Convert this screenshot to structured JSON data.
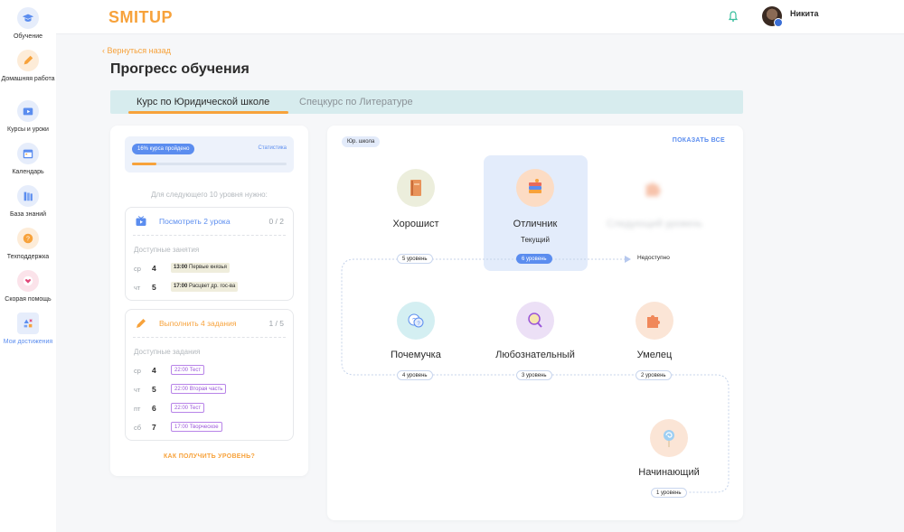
{
  "sidebar": {
    "items": [
      {
        "label": "Обучение",
        "icon": "graduation-cap-icon",
        "color": "#5b8def"
      },
      {
        "label": "Домашняя работа",
        "icon": "pencil-icon",
        "color": "#f7a23b"
      },
      {
        "label": "Курсы и уроки",
        "icon": "video-icon",
        "color": "#5b8def"
      },
      {
        "label": "Календарь",
        "icon": "calendar-icon",
        "color": "#5b8def"
      },
      {
        "label": "База знаний",
        "icon": "books-icon",
        "color": "#5b8def"
      },
      {
        "label": "Техподдержка",
        "icon": "question-icon",
        "color": "#f7a23b"
      },
      {
        "label": "Скорая помощь",
        "icon": "heart-icon",
        "color": "#e0497a"
      },
      {
        "label": "Мои достижения",
        "icon": "shapes-icon",
        "color": "#5b8def",
        "active": true
      }
    ]
  },
  "header": {
    "logo": "SMITUP",
    "user_name": "Никита"
  },
  "page": {
    "back_label": "Вернуться назад",
    "title": "Прогресс обучения",
    "tabs": [
      {
        "label": "Курс по Юридической  школе",
        "active": true
      },
      {
        "label": "Спецкурс по Литературе",
        "active": false
      }
    ]
  },
  "left": {
    "progress_label": "16% курса пройдено",
    "progress_value": 0.16,
    "stats_link": "Статистика",
    "next_level_text": "Для следующего 10 уровня нужно:",
    "watch": {
      "title": "Посмотреть 2 урока",
      "count": "0 / 2",
      "subtitle": "Доступные занятия",
      "rows": [
        {
          "day": "ср",
          "date": "4",
          "time": "13:00",
          "text": "Первые князья"
        },
        {
          "day": "чт",
          "date": "5",
          "time": "17:00",
          "text": "Расцвет др. гос-ва"
        }
      ]
    },
    "tasks": {
      "title": "Выполнить 4 задания",
      "count": "1 / 5",
      "subtitle": "Доступные задания",
      "rows": [
        {
          "day": "ср",
          "date": "4",
          "time": "22:00",
          "text": "Тест"
        },
        {
          "day": "чт",
          "date": "5",
          "time": "22:00",
          "text": "Вторая часть"
        },
        {
          "day": "пт",
          "date": "6",
          "time": "22:00",
          "text": "Тест"
        },
        {
          "day": "сб",
          "date": "7",
          "time": "17:00",
          "text": "Творческое"
        }
      ]
    },
    "how_link": "КАК ПОЛУЧИТЬ УРОВЕНЬ?"
  },
  "right": {
    "school_tag": "Юр. школа",
    "show_all": "ПОКАЗАТЬ ВСЕ",
    "achievements": {
      "good": {
        "name": "Хорошист",
        "level": "5 уровень"
      },
      "excellent": {
        "name": "Отличник",
        "sub": "Текущий",
        "level": "6 уровень"
      },
      "next": {
        "name": "Следующий уровень",
        "status": "Недоступно"
      },
      "why": {
        "name": "Почемучка",
        "level": "4 уровень"
      },
      "curious": {
        "name": "Любознательный",
        "level": "3 уровень"
      },
      "skilled": {
        "name": "Умелец",
        "level": "2 уровень"
      },
      "beginner": {
        "name": "Начинающий",
        "level": "1 уровень"
      }
    }
  },
  "colors": {
    "accent_orange": "#f7a23b",
    "accent_blue": "#5b8def",
    "tab_bg": "#d7ecee",
    "violet": "#b884e8"
  }
}
